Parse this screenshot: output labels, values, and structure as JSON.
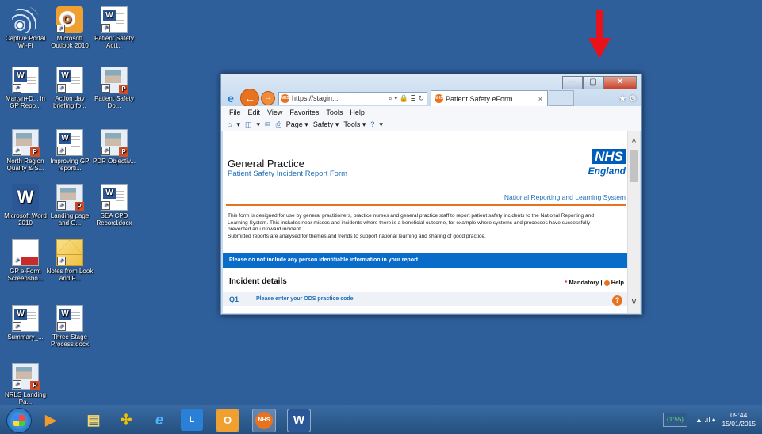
{
  "desktop": {
    "icons": [
      {
        "label": "Captive Portal Wi-Fi",
        "kind": "wifi"
      },
      {
        "label": "Microsoft Outlook 2010",
        "kind": "outlook"
      },
      {
        "label": "Patient Safety Acti...",
        "kind": "word-doc"
      },
      {
        "label": "Martyn+D... in GP Repo...",
        "kind": "word-doc"
      },
      {
        "label": "Action day briefing fo...",
        "kind": "word-doc"
      },
      {
        "label": "Patient Safety Do...",
        "kind": "publisher"
      },
      {
        "label": "North Region Quality & S...",
        "kind": "publisher"
      },
      {
        "label": "Improving GP reporti...",
        "kind": "word-doc"
      },
      {
        "label": "PDR Objectiv...",
        "kind": "publisher"
      },
      {
        "label": "Microsoft Word 2010",
        "kind": "word-app"
      },
      {
        "label": "Landing page and G...",
        "kind": "publisher"
      },
      {
        "label": "SEA CPD Record.docx",
        "kind": "word-doc"
      },
      {
        "label": "GP e-Form Screensho...",
        "kind": "pdf"
      },
      {
        "label": "Notes from Look and F...",
        "kind": "mail"
      },
      {
        "label": "Summary_...",
        "kind": "word-doc"
      },
      {
        "label": "Three Stage Process.docx",
        "kind": "word-doc"
      },
      {
        "label": "NRLS Landing Pa...",
        "kind": "publisher"
      }
    ]
  },
  "browser": {
    "address": "https://stagin...",
    "address_icons": "⌕ ▾ 🔒 ≣ ↻",
    "tab_title": "Patient Safety eForm",
    "tab_close": "×",
    "right_icons": "★ ⚙",
    "window_buttons": {
      "minimize": "—",
      "maximize": "▢",
      "close": "✕"
    },
    "menu": [
      "File",
      "Edit",
      "View",
      "Favorites",
      "Tools",
      "Help"
    ],
    "commands": [
      "▾",
      "▾",
      "Page ▾",
      "Safety ▾",
      "Tools ▾",
      "▾"
    ]
  },
  "page": {
    "title": "General Practice",
    "subtitle": "Patient Safety Incident Report Form",
    "logo_nhs": "NHS",
    "logo_region": "England",
    "nrls": "National Reporting and Learning System",
    "intro": "This form is designed for use by general practitioners, practice nurses and general practice staff to report patient safety incidents to the National Reporting and Learning System. This includes near misses and incidents where there is a beneficial outcome, for example where systems and processes have successfully prevented an untoward incident.",
    "intro2": "Submitted reports are analysed for themes and trends to support national learning and sharing of good practice.",
    "notice": "Please do not include any person identifiable information in your report.",
    "section_title": "Incident details",
    "mandatory_label": "Mandatory",
    "help_label": "Help",
    "question": {
      "number": "Q1",
      "text": "Please enter your ODS practice code",
      "help": "?"
    }
  },
  "taskbar": {
    "battery": "(1:55)",
    "clock_time": "09:44",
    "clock_date": "15/01/2015"
  },
  "colors": {
    "nhs_blue": "#005eb8",
    "accent_orange": "#e8731f",
    "arrow_red": "#e8121b"
  }
}
